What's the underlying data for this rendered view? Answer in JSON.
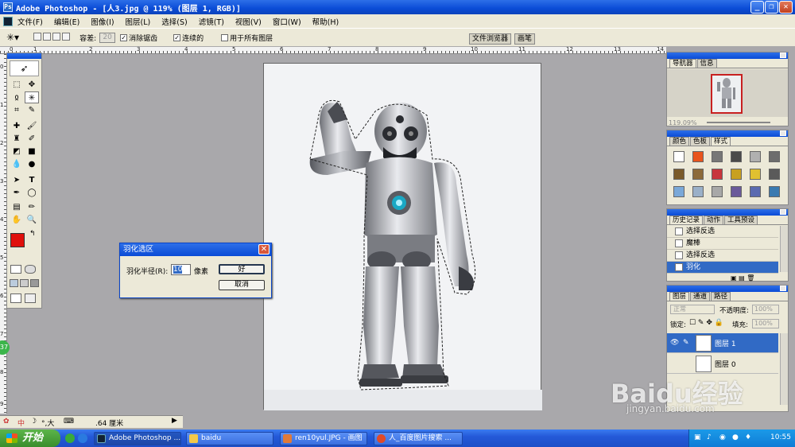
{
  "window": {
    "title": "Adobe Photoshop - [人3.jpg @ 119% (图层 1, RGB)]",
    "minimize": "_",
    "restore": "❐",
    "close": "✕"
  },
  "menu": [
    "文件(F)",
    "编辑(E)",
    "图像(I)",
    "图层(L)",
    "选择(S)",
    "滤镜(T)",
    "视图(V)",
    "窗口(W)",
    "帮助(H)"
  ],
  "options": {
    "tolerance_label": "容差:",
    "tolerance_value": "20",
    "antialias_label": "消除锯齿",
    "antialias_checked": true,
    "contiguous_label": "连续的",
    "contiguous_checked": true,
    "all_layers_label": "用于所有图层",
    "all_layers_checked": false,
    "tab_file_browser": "文件浏览器",
    "tab_brushes": "画笔"
  },
  "ruler": {
    "top_numbers": [
      "0",
      "1",
      "2",
      "3",
      "4",
      "5",
      "6",
      "7",
      "8",
      "9",
      "10",
      "11",
      "12",
      "13",
      "14"
    ],
    "left_numbers": [
      "0",
      "1",
      "2",
      "3",
      "4",
      "5",
      "6",
      "7",
      "8",
      "9"
    ]
  },
  "dialog": {
    "title": "羽化选区",
    "radius_label": "羽化半径(R):",
    "radius_value": "10",
    "unit": "像素",
    "ok": "好",
    "cancel": "取消"
  },
  "navigator": {
    "tabs": [
      "导航器",
      "信息"
    ],
    "zoom": "119.09%"
  },
  "color_panel": {
    "tabs": [
      "颜色",
      "色板",
      "样式"
    ],
    "swatch_colors": [
      "#ffffff",
      "#e8541c",
      "#777777",
      "#4a4a4a",
      "#b0b0b0",
      "#6d6d6d",
      "#7a5a2a",
      "#8c6a3a",
      "#c8353c",
      "#c8a020",
      "#e0c030",
      "#5a5a5a",
      "#7aa8d8",
      "#9ab0c8",
      "#a8a8a8",
      "#6a5a9a",
      "#5a6ab0",
      "#3a7ab0"
    ]
  },
  "history": {
    "tabs": [
      "历史记录",
      "动作",
      "工具预设"
    ],
    "items": [
      "选择反选",
      "魔棒",
      "选择反选",
      "羽化"
    ],
    "active_index": 3
  },
  "layers": {
    "tabs": [
      "图层",
      "通道",
      "路径"
    ],
    "blend_mode": "正常",
    "opacity_label": "不透明度:",
    "opacity_value": "100%",
    "lock_label": "锁定:",
    "fill_label": "填充:",
    "fill_value": "100%",
    "items": [
      {
        "name": "图层 1",
        "selected": true
      },
      {
        "name": "图层 0",
        "selected": false
      }
    ]
  },
  "status": {
    "ime": "中",
    "ime_extra": "°,大",
    "size": ".64 厘米"
  },
  "badge": "37",
  "taskbar": {
    "start": "开始",
    "tasks": [
      "Adobe Photoshop ...",
      "baidu",
      "ren10yul.JPG - 画图",
      "人_百度图片搜索 ..."
    ],
    "time": "10:55"
  },
  "watermark": {
    "brand": "Baidu经验",
    "url": "jingyan.baidu.com"
  },
  "colors": {
    "foreground": "#e0100c",
    "background": "#000000",
    "titlebar": "#0a4bd6",
    "selection": "#316ac5"
  }
}
